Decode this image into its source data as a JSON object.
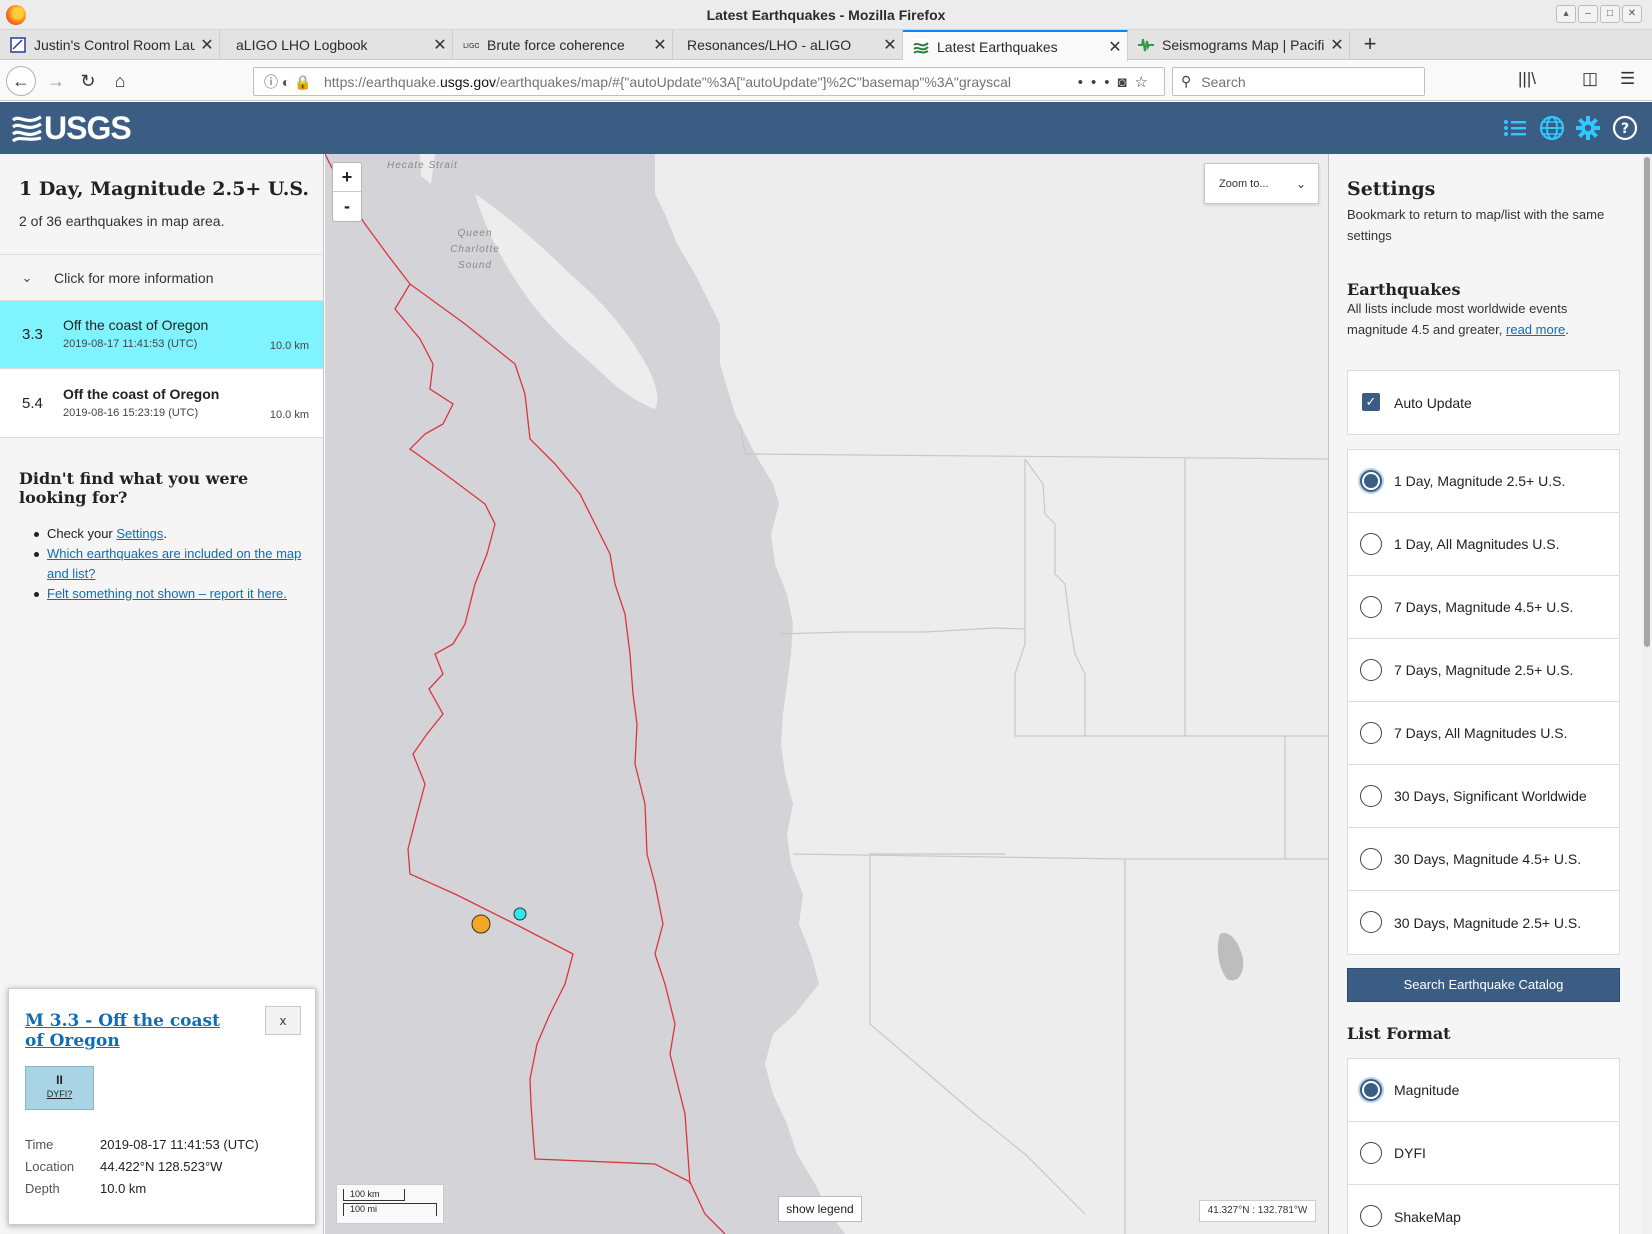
{
  "window": {
    "title": "Latest Earthquakes - Mozilla Firefox"
  },
  "tabs": [
    {
      "label": "Justin's Control Room Laun"
    },
    {
      "label": "aLIGO LHO Logbook"
    },
    {
      "label": "Brute force coherence"
    },
    {
      "label": "Resonances/LHO - aLIGO"
    },
    {
      "label": "Latest Earthquakes"
    },
    {
      "label": "Seismograms Map | Pacific"
    }
  ],
  "navbar": {
    "url_prefix": "https://earthquake.",
    "url_domain": "usgs.gov",
    "url_rest": "/earthquakes/map/#{\"autoUpdate\"%3A[\"autoUpdate\"]%2C\"basemap\"%3A\"grayscal",
    "search_placeholder": "Search"
  },
  "header": {
    "logo_text": "USGS"
  },
  "list": {
    "title": "1 Day, Magnitude 2.5+ U.S.",
    "count_text": "2 of 36 earthquakes in map area.",
    "more_info": "Click for more information",
    "items": [
      {
        "mag": "3.3",
        "place": "Off the coast of Oregon",
        "time": "2019-08-17 11:41:53 (UTC)",
        "depth": "10.0 km"
      },
      {
        "mag": "5.4",
        "place": "Off the coast of Oregon",
        "time": "2019-08-16 15:23:19 (UTC)",
        "depth": "10.0 km"
      }
    ],
    "notfound_title": "Didn't find what you were looking for?",
    "notfound_check_prefix": "Check your ",
    "notfound_settings_link": "Settings",
    "notfound_check_suffix": ".",
    "notfound_link2": "Which earthquakes are included on the map and list?",
    "notfound_link3": "Felt something not shown – report it here."
  },
  "popup": {
    "title": "M 3.3 - Off the coast of Oregon",
    "close_label": "x",
    "dyfi_value": "II",
    "dyfi_label": "DYFI?",
    "time_label": "Time",
    "time_value": "2019-08-17 11:41:53 (UTC)",
    "location_label": "Location",
    "location_value": "44.422°N 128.523°W",
    "depth_label": "Depth",
    "depth_value": "10.0 km"
  },
  "map": {
    "zoom_in": "+",
    "zoom_out": "-",
    "zoom_to": "Zoom to...",
    "label_hecate": "Hecate Strait",
    "label_queen": "Queen Charlotte Sound",
    "scale_km": "100 km",
    "scale_mi": "100 mi",
    "show_legend": "show legend",
    "coords": "41.327°N : 132.781°W",
    "colors": {
      "ocean": "#d4d4d8",
      "land": "#ededed",
      "plate_boundary": "#d9363e",
      "eq_recent": "#2ee6f0",
      "eq_day": "#f5a623"
    }
  },
  "settings": {
    "title": "Settings",
    "bookmark_text": "Bookmark to return to map/list with the same settings",
    "earthquakes_heading": "Earthquakes",
    "earthquakes_text": "All lists include most worldwide events magnitude 4.5 and greater, ",
    "read_more": "read more",
    "period": ".",
    "auto_update_label": "Auto Update",
    "feeds": [
      {
        "label": "1 Day, Magnitude 2.5+ U.S."
      },
      {
        "label": "1 Day, All Magnitudes U.S."
      },
      {
        "label": "7 Days, Magnitude 4.5+ U.S."
      },
      {
        "label": "7 Days, Magnitude 2.5+ U.S."
      },
      {
        "label": "7 Days, All Magnitudes U.S."
      },
      {
        "label": "30 Days, Significant Worldwide"
      },
      {
        "label": "30 Days, Magnitude 4.5+ U.S."
      },
      {
        "label": "30 Days, Magnitude 2.5+ U.S."
      }
    ],
    "search_catalog": "Search Earthquake Catalog",
    "list_format_heading": "List Format",
    "list_formats": [
      {
        "label": "Magnitude"
      },
      {
        "label": "DYFI"
      },
      {
        "label": "ShakeMap"
      }
    ]
  }
}
